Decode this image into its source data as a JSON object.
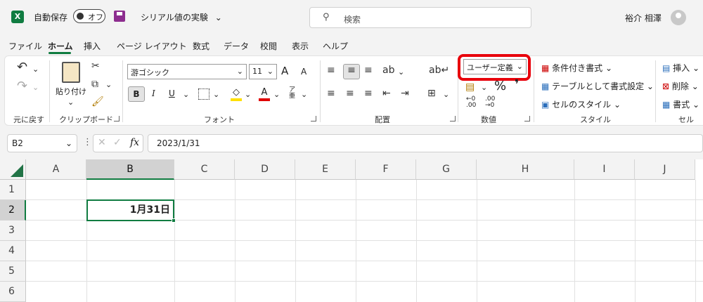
{
  "titlebar": {
    "app_icon": "X",
    "autosave_label": "自動保存",
    "autosave_state": "オフ",
    "doc_title": "シリアル値の実験",
    "doc_title_caret": "⌄",
    "search_placeholder": "検索",
    "user_name": "裕介 相澤"
  },
  "tabs": [
    "ファイル",
    "ホーム",
    "挿入",
    "ページ レイアウト",
    "数式",
    "データ",
    "校閲",
    "表示",
    "ヘルプ"
  ],
  "active_tab": "ホーム",
  "ribbon": {
    "undo_group_label": "元に戻す",
    "paste_label": "貼り付け",
    "clipboard_group_label": "クリップボード",
    "font_name": "游ゴシック",
    "font_size": "11",
    "bold": "B",
    "italic": "I",
    "underline": "U",
    "grow_font": "A",
    "shrink_font": "A",
    "font_group_label": "フォント",
    "align_group_label": "配置",
    "number_format": "ユーザー定義",
    "percent": "%",
    "comma": "❜",
    "dec_inc": "←0\n.00",
    "dec_dec": ".00\n→0",
    "number_group_label": "数値",
    "cond_format": "条件付き書式",
    "format_table": "テーブルとして書式設定",
    "cell_styles": "セルのスタイル",
    "styles_group_label": "スタイル",
    "insert": "挿入",
    "delete": "削除",
    "format": "書式",
    "cells_group_label": "セル"
  },
  "formula_bar": {
    "name_box": "B2",
    "fx": "fx",
    "formula": "2023/1/31"
  },
  "grid": {
    "columns": [
      "A",
      "B",
      "C",
      "D",
      "E",
      "F",
      "G",
      "H",
      "I",
      "J"
    ],
    "rows": [
      "1",
      "2",
      "3",
      "4",
      "5",
      "6"
    ],
    "selected_cell_value": "1月31日"
  },
  "colors": {
    "accent": "#107c41",
    "highlight": "#e8000b"
  }
}
